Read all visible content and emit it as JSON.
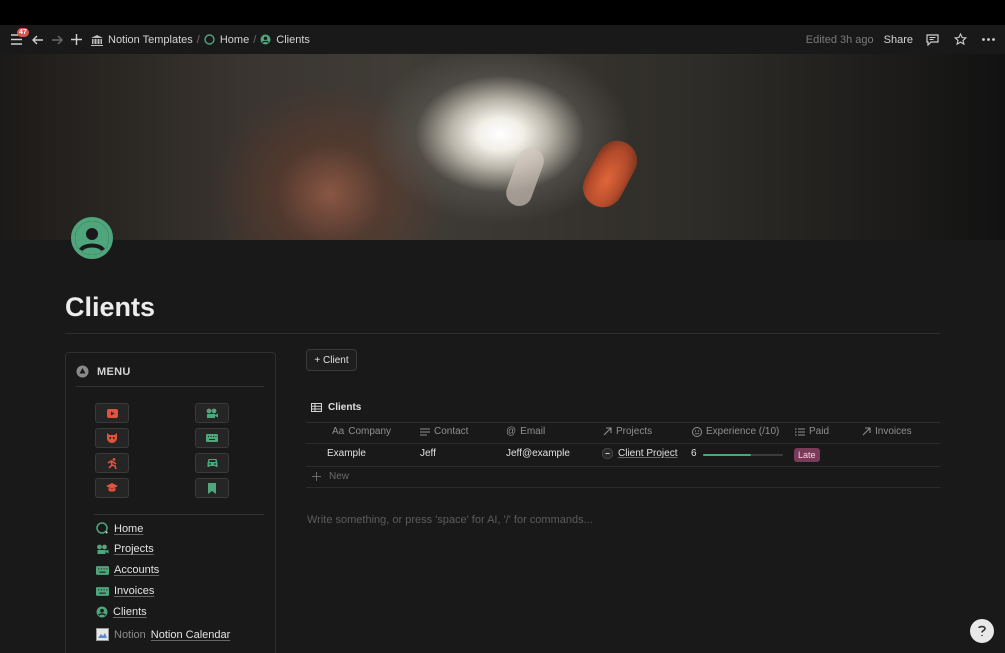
{
  "topbar": {
    "badge_count": "47",
    "breadcrumbs": [
      {
        "label": "Notion Templates"
      },
      {
        "label": "Home"
      },
      {
        "label": "Clients"
      }
    ],
    "edited": "Edited 3h ago",
    "share_label": "Share"
  },
  "page": {
    "title": "Clients"
  },
  "menu": {
    "title": "MENU",
    "icon_buttons": [
      {
        "icon": "youtube-icon",
        "color": "#e0533f"
      },
      {
        "icon": "projector-icon",
        "color": "#4fa57c"
      },
      {
        "icon": "mask-icon",
        "color": "#e0533f"
      },
      {
        "icon": "keyboard-icon",
        "color": "#4fa57c"
      },
      {
        "icon": "runner-icon",
        "color": "#e0533f"
      },
      {
        "icon": "car-icon",
        "color": "#4fa57c"
      },
      {
        "icon": "graduation-cap-icon",
        "color": "#e0533f"
      },
      {
        "icon": "bookmark-icon",
        "color": "#4fa57c"
      }
    ],
    "links": [
      {
        "label": "Home"
      },
      {
        "label": "Projects"
      },
      {
        "label": "Accounts"
      },
      {
        "label": "Invoices"
      },
      {
        "label": "Clients"
      },
      {
        "prefix": "Notion",
        "label": "Notion Calendar"
      }
    ]
  },
  "add_button_label": "+ Client",
  "database": {
    "title": "Clients",
    "columns": [
      {
        "prefix": "Aa",
        "label": "Company"
      },
      {
        "label": "Contact"
      },
      {
        "label": "Email"
      },
      {
        "label": "Projects"
      },
      {
        "label": "Experience (/10)"
      },
      {
        "label": "Paid"
      },
      {
        "label": "Invoices"
      }
    ],
    "rows": [
      {
        "company": "Example",
        "contact": "Jeff",
        "email": "Jeff@example",
        "project": "Client Project",
        "experience": "6",
        "experience_fraction": 0.6,
        "paid": "Late"
      }
    ],
    "new_label": "New"
  },
  "editor_placeholder": "Write something, or press 'space' for AI, '/' for commands...",
  "help_label": "?",
  "colors": {
    "accent_green": "#4fa57c",
    "accent_red": "#e0533f",
    "late_tag": "#7a3b5a"
  }
}
